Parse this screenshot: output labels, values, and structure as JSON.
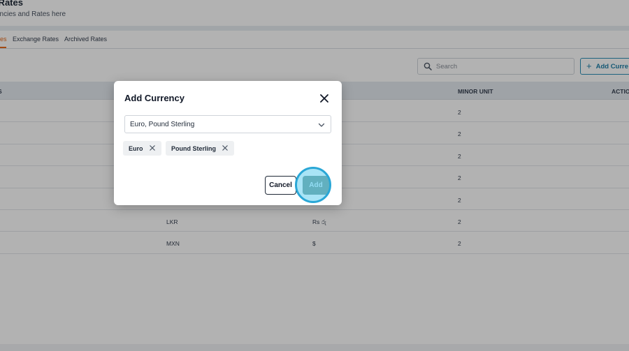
{
  "page": {
    "title": "d Rates",
    "subtitle": "encies and Rates here"
  },
  "tabs": [
    {
      "label": "es",
      "active": true
    },
    {
      "label": "Exchange Rates",
      "active": false
    },
    {
      "label": "Archived Rates",
      "active": false
    }
  ],
  "search": {
    "placeholder": "Search",
    "value": ""
  },
  "add_button_label": "Add Curre",
  "table": {
    "headers": [
      "S",
      "MINOR UNIT",
      "ACTIO"
    ],
    "rows": [
      {
        "code": "",
        "symbol": "",
        "minor_unit": "2"
      },
      {
        "code": "",
        "symbol": "",
        "minor_unit": "2"
      },
      {
        "code": "",
        "symbol": "",
        "minor_unit": "2"
      },
      {
        "code": "",
        "symbol": "",
        "minor_unit": "2"
      },
      {
        "code": "",
        "symbol": "",
        "minor_unit": "2"
      },
      {
        "code": "LKR",
        "symbol": "Rs රු",
        "minor_unit": "2"
      },
      {
        "code": "MXN",
        "symbol": "$",
        "minor_unit": "2"
      }
    ]
  },
  "modal": {
    "title": "Add Currency",
    "select_value": "Euro, Pound Sterling",
    "chips": [
      {
        "label": "Euro"
      },
      {
        "label": "Pound Sterling"
      }
    ],
    "cancel_label": "Cancel",
    "add_label": "Add"
  },
  "colors": {
    "accent": "#e86b1c",
    "primary": "#1e7fa8",
    "overlay": "rgba(0,0,0,0.30)",
    "click_highlight": "#2aa7d6"
  },
  "icons": {
    "search": "search-icon",
    "close": "close-icon",
    "chevron": "chevron-down-icon",
    "chip_remove": "x-icon",
    "plus": "plus-icon"
  }
}
